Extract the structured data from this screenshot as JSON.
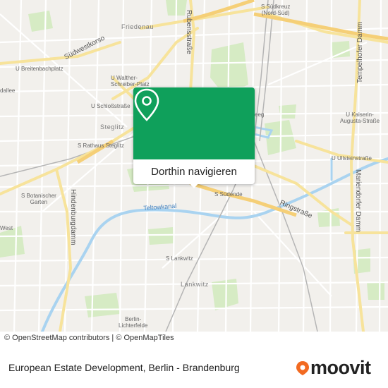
{
  "map": {
    "district_labels": {
      "friedenau": "Friedenau",
      "steglitz": "Steglitz",
      "lankwitz": "Lankwitz"
    },
    "road_labels": {
      "suedwestkorso": "Südwestkorso",
      "rubensstrasse": "Rubensstraße",
      "tempelhofer_damm": "Tempelhofer Damm",
      "mariendorfer_damm": "Mariendorfer Damm",
      "hindenburgdamm": "Hindenburgdamm",
      "ringstrasse": "Ringstraße",
      "teltowkanal": "Teltowkanal"
    },
    "station_labels": {
      "suedkreuz": "S Südkreuz\n(Nord-Süd)",
      "breitenbachplatz": "U Breitenbachplatz",
      "walther_schreiber": "U Walther-\nSchreiber-Platz",
      "schlossstrasse": "U Schloßstraße",
      "rathaus_steglitz": "S Rathaus Steglitz",
      "botanischer_garten": "S Botanischer\nGarten",
      "suedende": "S Südende",
      "lankwitz": "S Lankwitz",
      "lichterfelde": "Berlin-\nLichterfelde",
      "kaiserin_augusta": "U Kaiserin-\nAugusta-Straße",
      "ullsteinstrasse": "U Ullsteinstraße",
      "allee_fragment": "dallee",
      "west_fragment": "West",
      "eeg_fragment": "eeg"
    },
    "colors": {
      "background": "#f2f0ec",
      "park": "#d6ebc4",
      "water": "#a9d3f0",
      "major_road": "#f7e39b",
      "minor_road": "#ffffff",
      "rail": "#b5b5b5"
    }
  },
  "popup": {
    "button_label": "Dorthin navigieren",
    "header_color": "#0fa05b",
    "icon": "location-pin-icon"
  },
  "attribution": "© OpenStreetMap contributors | © OpenMapTiles",
  "footer": {
    "title": "European Estate Development, Berlin - Brandenburg",
    "logo_text": "moovit",
    "logo_color": "#f26a21"
  }
}
